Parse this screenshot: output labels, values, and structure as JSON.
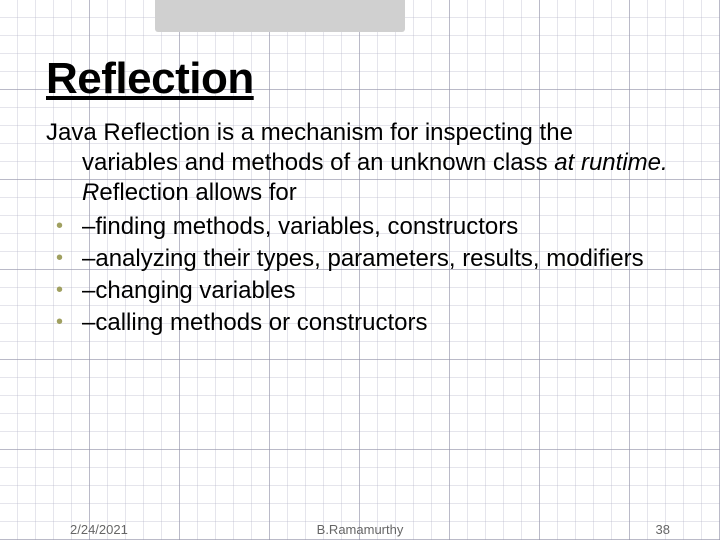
{
  "title": "Reflection",
  "intro_plain1": "Java Reflection is a  mechanism for inspecting the variables and methods of an unknown class ",
  "intro_italic": "at runtime. R",
  "intro_plain2": "eflection allows for",
  "bullets": [
    "–finding methods, variables, constructors",
    "–analyzing their types, parameters, results, modifiers",
    "–changing variables",
    "–calling methods or constructors"
  ],
  "footer": {
    "date": "2/24/2021",
    "author": "B.Ramamurthy",
    "page": "38"
  },
  "colors": {
    "bullet": "#a0a060",
    "shadow": "#d0d0d0"
  }
}
